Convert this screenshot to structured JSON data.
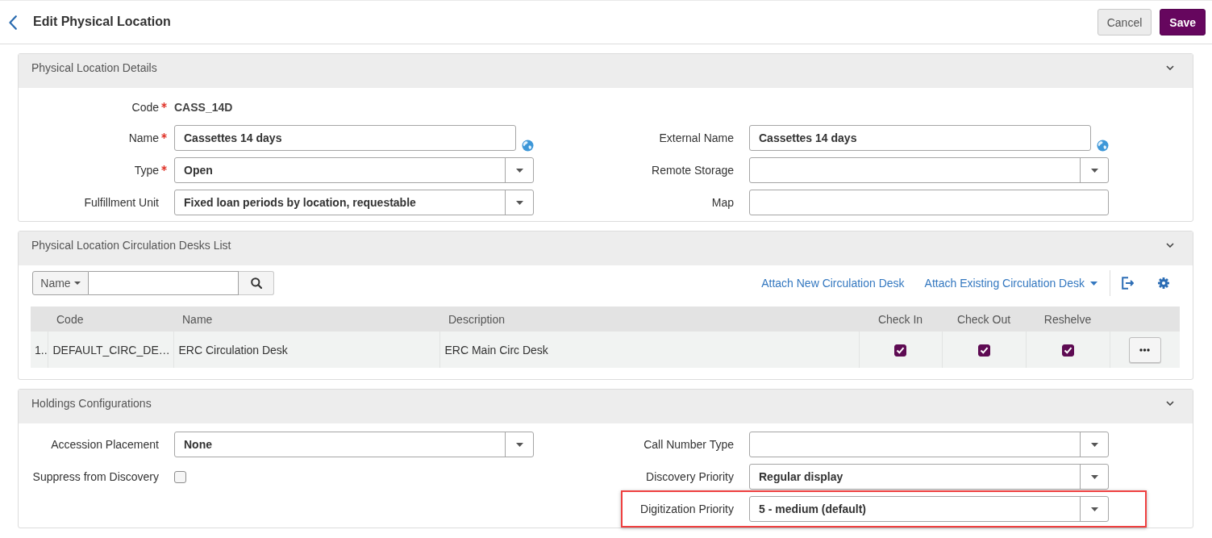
{
  "header": {
    "title": "Edit Physical Location",
    "buttons": [
      {
        "label": "Cancel",
        "kind": "secondary"
      },
      {
        "label": "Save",
        "kind": "primary"
      }
    ]
  },
  "sections": [
    {
      "kind": "form",
      "title": "Physical Location Details",
      "expanded": true,
      "rows": [
        {
          "left": {
            "label": "Code",
            "required": true,
            "kind": "text",
            "value": "CASS_14D"
          }
        },
        {
          "left": {
            "label": "Name",
            "required": true,
            "kind": "input",
            "value": "Cassettes 14 days",
            "translatable": true
          },
          "right": {
            "label": "External Name",
            "required": false,
            "kind": "input",
            "value": "Cassettes 14 days",
            "translatable": true
          }
        },
        {
          "left": {
            "label": "Type",
            "required": true,
            "kind": "select",
            "value": "Open"
          },
          "right": {
            "label": "Remote Storage",
            "required": false,
            "kind": "select"
          }
        },
        {
          "left": {
            "label": "Fulfillment Unit",
            "required": false,
            "kind": "select",
            "value": "Fixed loan periods by location, requestable"
          },
          "right": {
            "label": "Map",
            "required": false,
            "kind": "input"
          }
        }
      ]
    },
    {
      "kind": "table",
      "title": "Physical Location Circulation Desks List",
      "expanded": true,
      "search": {
        "scope": "Name"
      },
      "actions": [
        {
          "label": "Attach New Circulation Desk",
          "kind": "link"
        },
        {
          "label": "Attach Existing Circulation Desk",
          "kind": "dropdown"
        }
      ],
      "columns": [
        {
          "label": "Code",
          "kind": "text"
        },
        {
          "label": "Name",
          "kind": "text"
        },
        {
          "label": "Description",
          "kind": "text"
        },
        {
          "label": "Check In",
          "kind": "check"
        },
        {
          "label": "Check Out",
          "kind": "check"
        },
        {
          "label": "Reshelve",
          "kind": "check"
        }
      ],
      "rows": [
        {
          "number": "1..",
          "cells": [
            {
              "text": "DEFAULT_CIRC_DE…"
            },
            {
              "text": "ERC Circulation Desk"
            },
            {
              "text": "ERC Main Circ Desk"
            },
            {
              "checked": true
            },
            {
              "checked": true
            },
            {
              "checked": true
            }
          ]
        }
      ]
    },
    {
      "kind": "form",
      "title": "Holdings Configurations",
      "expanded": true,
      "rows": [
        {
          "left": {
            "label": "Accession Placement",
            "required": false,
            "kind": "select",
            "value": "None",
            "highlighted": false
          },
          "right": {
            "label": "Call Number Type",
            "required": false,
            "kind": "select",
            "highlighted": false
          }
        },
        {
          "left": {
            "label": "Suppress from Discovery",
            "required": false,
            "kind": "checkbox",
            "checked": false,
            "highlighted": false
          },
          "right": {
            "label": "Discovery Priority",
            "required": false,
            "kind": "select",
            "value": "Regular display",
            "highlighted": false
          }
        },
        {
          "right": {
            "label": "Digitization Priority",
            "required": false,
            "kind": "select",
            "value": "5 - medium (default)",
            "highlighted": true
          }
        }
      ]
    }
  ]
}
